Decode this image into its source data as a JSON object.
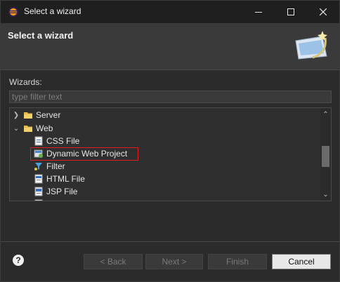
{
  "window": {
    "title": "Select a wizard"
  },
  "header": {
    "title": "Select a wizard"
  },
  "wizards": {
    "label": "Wizards:",
    "filter_placeholder": "type filter text",
    "tree": [
      {
        "label": "Server",
        "icon": "folder-icon",
        "expanded": false
      },
      {
        "label": "Web",
        "icon": "folder-icon",
        "expanded": true
      },
      {
        "label": "CSS File",
        "icon": "css-file-icon"
      },
      {
        "label": "Dynamic Web Project",
        "icon": "web-project-icon",
        "highlighted": true
      },
      {
        "label": "Filter",
        "icon": "filter-icon"
      },
      {
        "label": "HTML File",
        "icon": "html-file-icon"
      },
      {
        "label": "JSP File",
        "icon": "jsp-file-icon"
      }
    ]
  },
  "buttons": {
    "back": "< Back",
    "next": "Next >",
    "finish": "Finish",
    "cancel": "Cancel"
  },
  "colors": {
    "highlight_border": "#e02020",
    "background": "#2b2b2b",
    "header": "#3a3a3a"
  }
}
